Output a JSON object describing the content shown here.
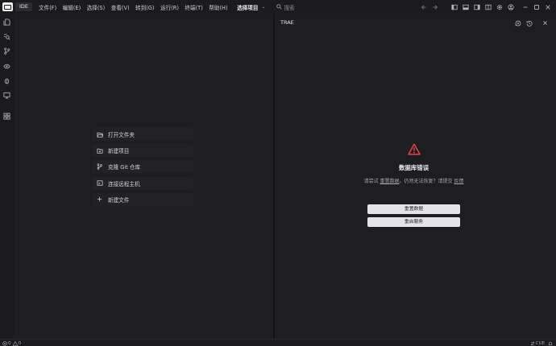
{
  "titlebar": {
    "mode": "IDE",
    "menu": [
      "文件(F)",
      "编辑(E)",
      "选择(S)",
      "查看(V)",
      "转到(G)",
      "运行(R)",
      "终端(T)",
      "帮助(H)"
    ],
    "project_select": "选择项目",
    "search_label": "搜索"
  },
  "welcome": {
    "items": [
      {
        "icon": "folder-open-icon",
        "label": "打开文件夹"
      },
      {
        "icon": "folder-plus-icon",
        "label": "新建项目"
      },
      {
        "icon": "git-branch-icon",
        "label": "克隆 Git 仓库"
      },
      {
        "icon": "remote-icon",
        "label": "连接远程主机"
      },
      {
        "icon": "plus-icon",
        "label": "新建文件"
      }
    ]
  },
  "panel": {
    "title": "TRAE",
    "error": {
      "title": "数据库错误",
      "msg_before": "请尝试 ",
      "msg_link1": "重置数据",
      "msg_middle": "。仍然无法恢复？请提交 ",
      "msg_link2": "反馈",
      "reset_button": "重置数据",
      "restart_button": "重启服务"
    }
  },
  "statusbar": {
    "errors": "0",
    "warnings": "0",
    "mode": "CUE"
  },
  "colors": {
    "warning_red": "#e0484d",
    "button_bg": "#e4e4e8"
  }
}
